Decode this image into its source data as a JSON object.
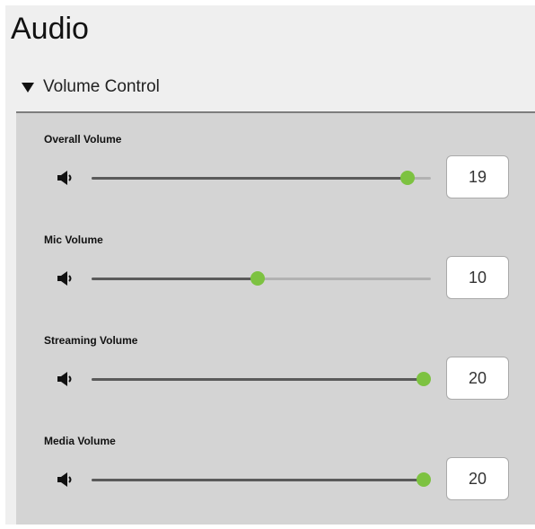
{
  "page": {
    "title": "Audio"
  },
  "section": {
    "label": "Volume Control",
    "expanded_icon": "triangle-down-icon"
  },
  "controls": [
    {
      "label": "Overall Volume",
      "value": "19",
      "slider_value": 19,
      "max": 20,
      "icon": "speaker-icon"
    },
    {
      "label": "Mic Volume",
      "value": "10",
      "slider_value": 10,
      "max": 20,
      "icon": "speaker-icon"
    },
    {
      "label": "Streaming Volume",
      "value": "20",
      "slider_value": 20,
      "max": 20,
      "icon": "speaker-icon"
    },
    {
      "label": "Media Volume",
      "value": "20",
      "slider_value": 20,
      "max": 20,
      "icon": "speaker-icon"
    }
  ],
  "colors": {
    "thumb": "#7dc241",
    "fill": "#5a5a5a",
    "track": "#b2b2b2",
    "panel": "#d4d4d4"
  }
}
